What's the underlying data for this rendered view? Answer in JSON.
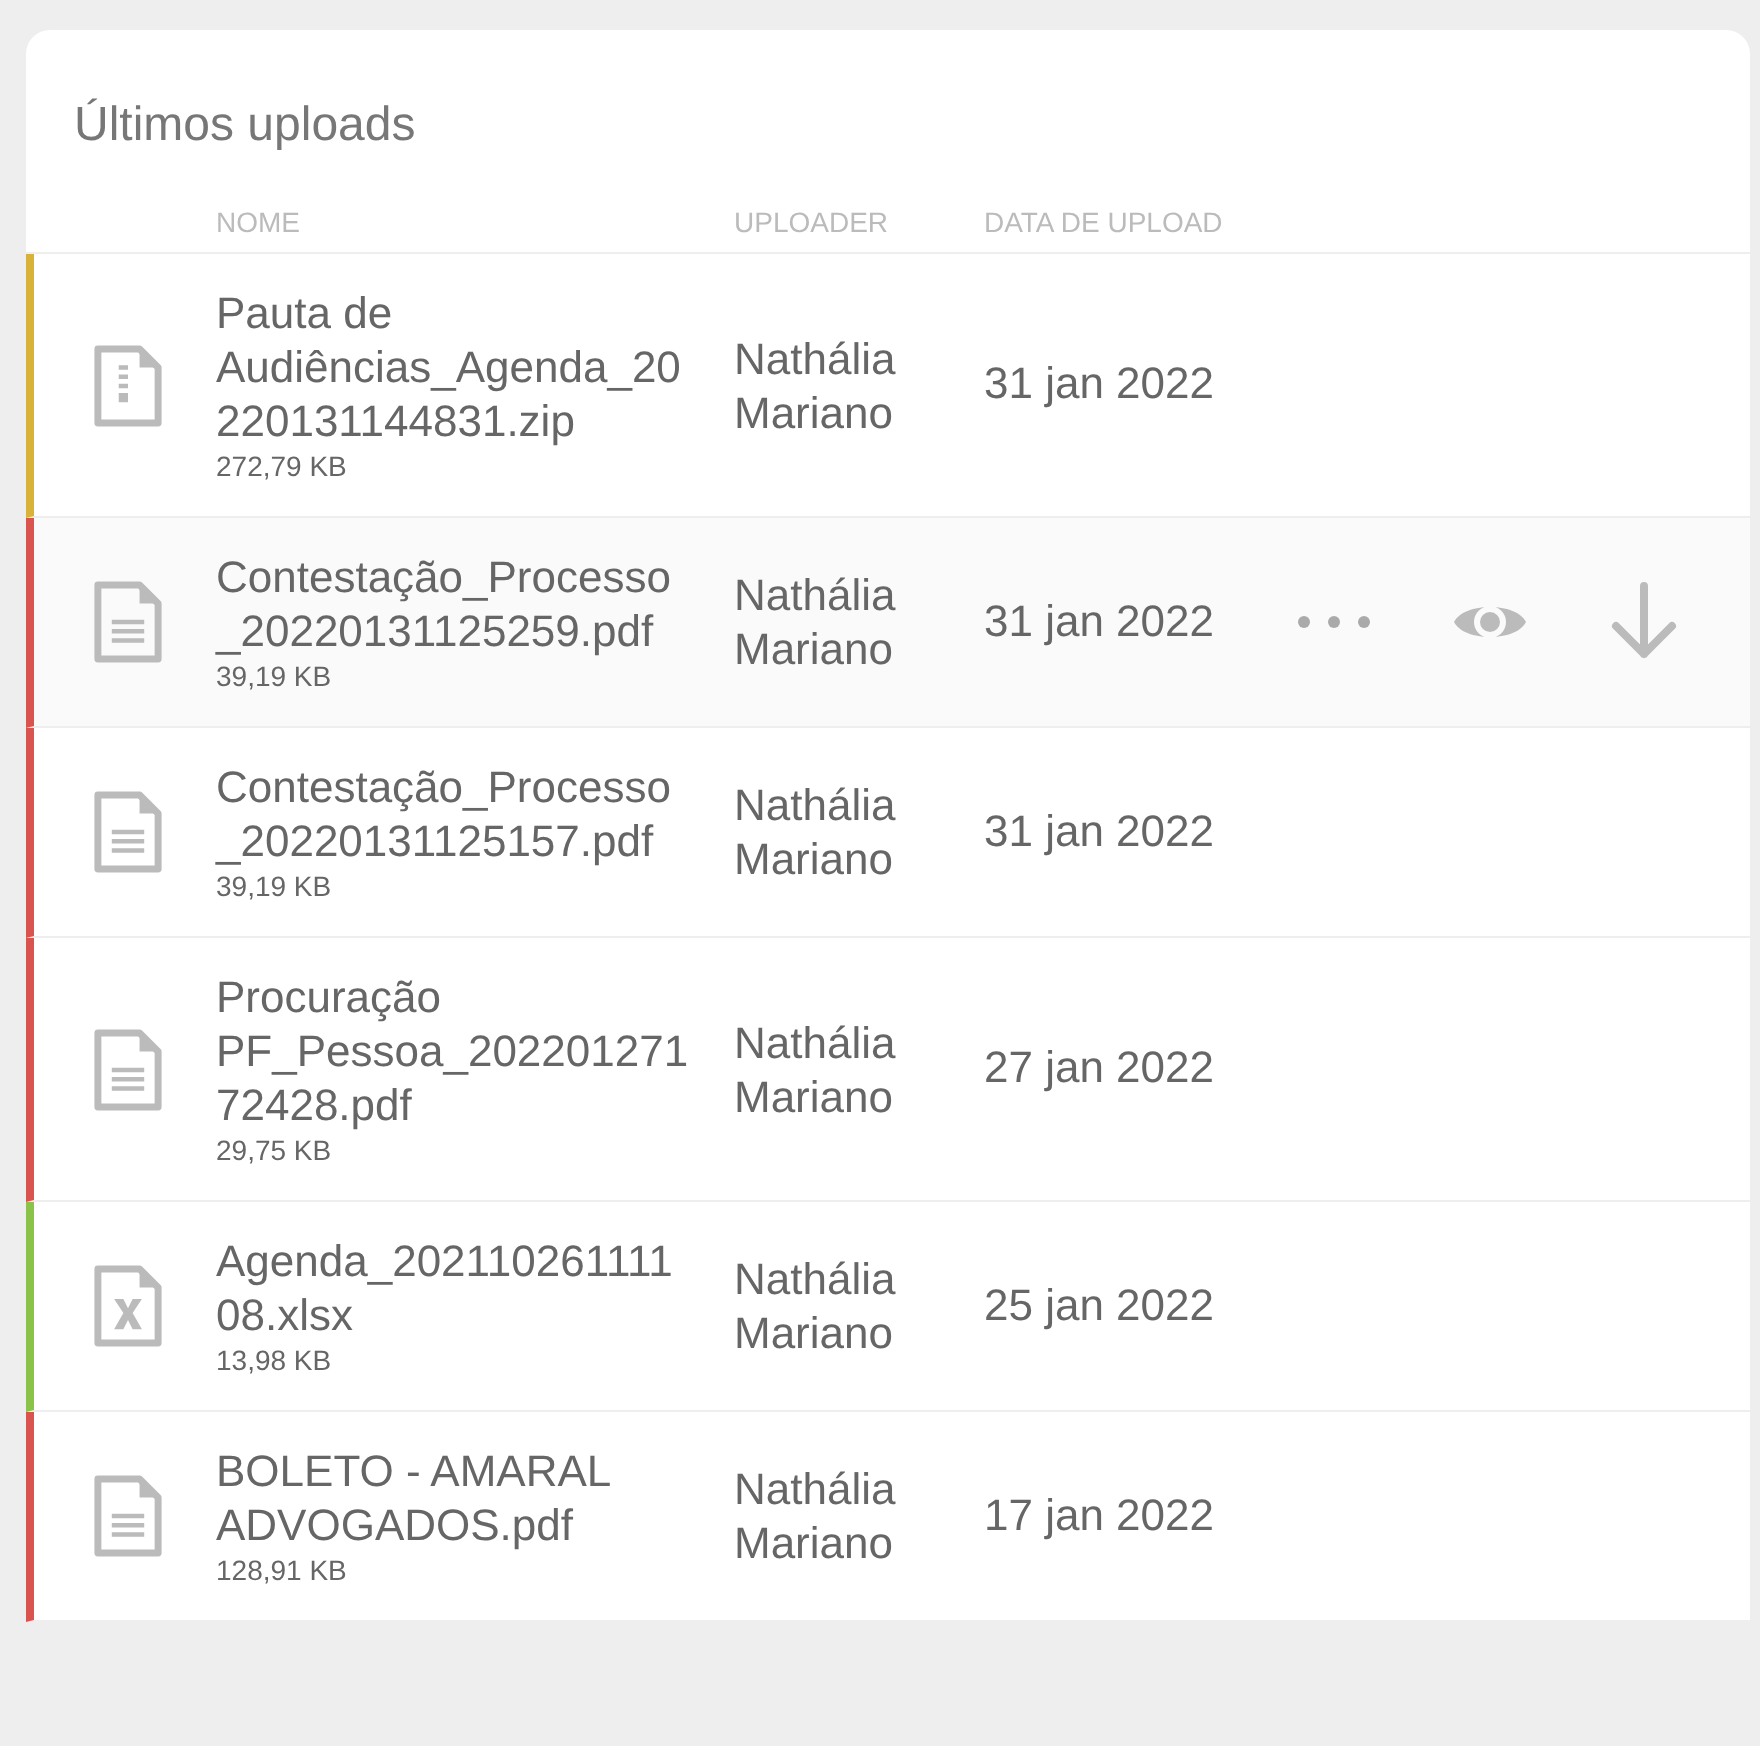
{
  "card": {
    "title": "Últimos uploads"
  },
  "table": {
    "columns": [
      "NOME",
      "UPLOADER",
      "DATA DE UPLOAD"
    ],
    "rows": [
      {
        "kind": "zip",
        "color": "#d9b23a",
        "name": "Pauta de Audiências_Agenda_20220131144831.zip",
        "size": "272,79 KB",
        "uploader": "Nathália Mariano",
        "date": "31 jan 2022",
        "hovered": false
      },
      {
        "kind": "pdf",
        "color": "#d9534f",
        "name": "Contestação_Processo_20220131125259.pdf",
        "size": "39,19 KB",
        "uploader": "Nathália Mariano",
        "date": "31 jan 2022",
        "hovered": true
      },
      {
        "kind": "pdf",
        "color": "#d9534f",
        "name": "Contestação_Processo_20220131125157.pdf",
        "size": "39,19 KB",
        "uploader": "Nathália Mariano",
        "date": "31 jan 2022",
        "hovered": false
      },
      {
        "kind": "pdf",
        "color": "#d9534f",
        "name": "Procuração PF_Pessoa_20220127172428.pdf",
        "size": "29,75 KB",
        "uploader": "Nathália Mariano",
        "date": "27 jan 2022",
        "hovered": false
      },
      {
        "kind": "xlsx",
        "color": "#8bc34a",
        "name": "Agenda_20211026111108.xlsx",
        "size": "13,98 KB",
        "uploader": "Nathália Mariano",
        "date": "25 jan 2022",
        "hovered": false
      },
      {
        "kind": "pdf",
        "color": "#d9534f",
        "name": "BOLETO - AMARAL ADVOGADOS.pdf",
        "size": "128,91 KB",
        "uploader": "Nathália Mariano",
        "date": "17 jan 2022",
        "hovered": false
      }
    ]
  }
}
